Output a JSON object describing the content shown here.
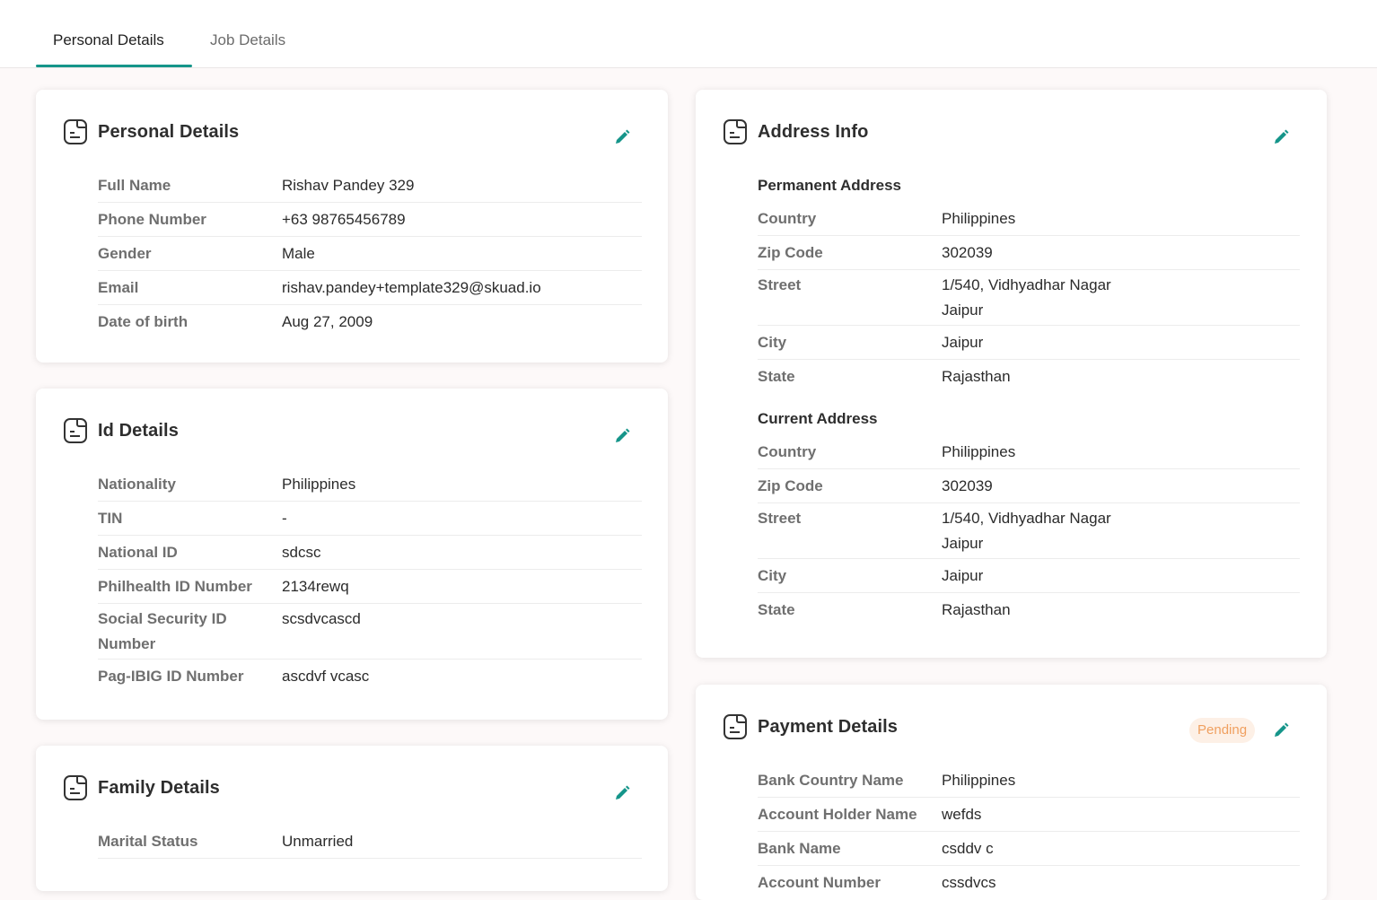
{
  "tabs": [
    {
      "label": "Personal Details"
    },
    {
      "label": "Job Details"
    }
  ],
  "colors": {
    "accent": "#15958a",
    "pending_text": "#f0a060",
    "pending_bg": "#fdf0e6"
  },
  "personal": {
    "title": "Personal Details",
    "rows": [
      {
        "label": "Full Name",
        "value": "Rishav Pandey 329"
      },
      {
        "label": "Phone Number",
        "value": "+63 98765456789"
      },
      {
        "label": "Gender",
        "value": "Male"
      },
      {
        "label": "Email",
        "value": "rishav.pandey+template329@skuad.io"
      },
      {
        "label": "Date of birth",
        "value": "Aug 27, 2009"
      }
    ]
  },
  "id_details": {
    "title": "Id Details",
    "rows": [
      {
        "label": "Nationality",
        "value": "Philippines"
      },
      {
        "label": "TIN",
        "value": "-"
      },
      {
        "label": "National ID",
        "value": "sdcsc"
      },
      {
        "label": "Philhealth ID Number",
        "value": "2134rewq"
      },
      {
        "label_line1": "Social Security ID",
        "label_line2": "Number",
        "value": "scsdvcascd"
      },
      {
        "label": "Pag-IBIG ID Number",
        "value": "ascdvf vcasc"
      }
    ]
  },
  "family": {
    "title": "Family Details",
    "rows": [
      {
        "label": "Marital Status",
        "value": "Unmarried"
      }
    ]
  },
  "address": {
    "title": "Address Info",
    "permanent": {
      "heading": "Permanent Address",
      "country_label": "Country",
      "country": "Philippines",
      "zip_label": "Zip Code",
      "zip": "302039",
      "street_label": "Street",
      "street_line1": "1/540, Vidhyadhar Nagar",
      "street_line2": "Jaipur",
      "city_label": "City",
      "city": "Jaipur",
      "state_label": "State",
      "state": "Rajasthan"
    },
    "current": {
      "heading": "Current Address",
      "country_label": "Country",
      "country": "Philippines",
      "zip_label": "Zip Code",
      "zip": "302039",
      "street_label": "Street",
      "street_line1": "1/540, Vidhyadhar Nagar",
      "street_line2": "Jaipur",
      "city_label": "City",
      "city": "Jaipur",
      "state_label": "State",
      "state": "Rajasthan"
    }
  },
  "payment": {
    "title": "Payment Details",
    "status": "Pending",
    "rows": [
      {
        "label": "Bank Country Name",
        "value": "Philippines"
      },
      {
        "label": "Account Holder Name",
        "value": "wefds"
      },
      {
        "label": "Bank Name",
        "value": "csddv c"
      },
      {
        "label": "Account Number",
        "value": "cssdvcs"
      }
    ]
  }
}
